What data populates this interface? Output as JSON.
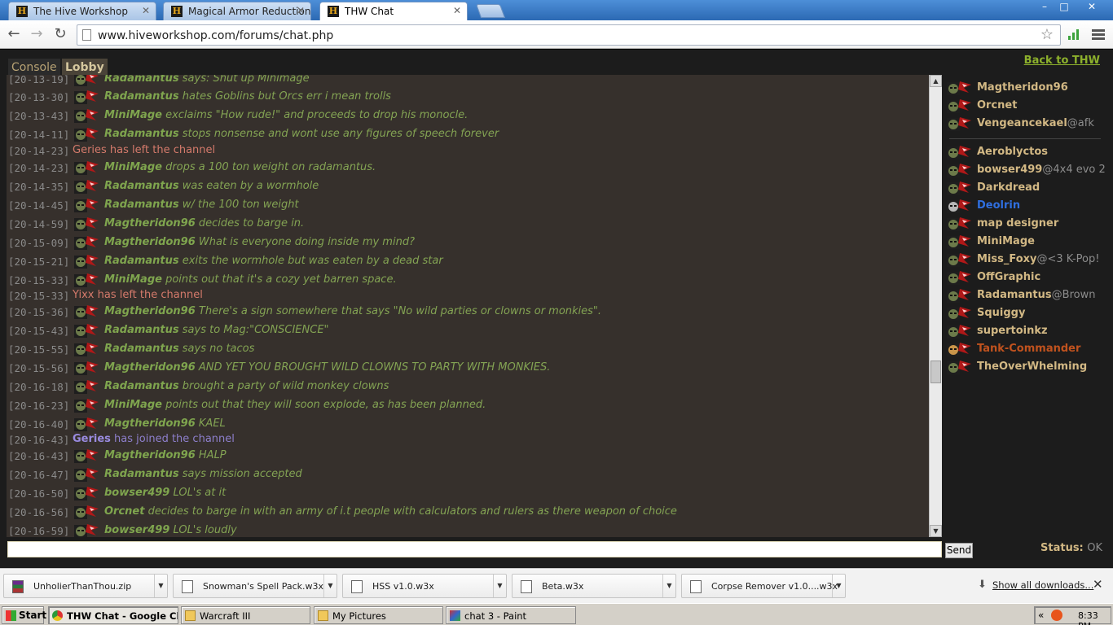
{
  "browser": {
    "tabs": [
      {
        "title": "The Hive Workshop",
        "favicon": "H"
      },
      {
        "title": "Magical Armor Reduction - Th",
        "favicon": "H"
      },
      {
        "title": "THW Chat",
        "favicon": "H"
      }
    ],
    "url": "www.hiveworkshop.com/forums/chat.php",
    "window_controls": [
      "–",
      "□",
      "✕"
    ]
  },
  "chat": {
    "channel_tabs": [
      "Console",
      "Lobby"
    ],
    "back_link": "Back to THW",
    "log": [
      {
        "ts": "[20-13-19]",
        "kind": "partial",
        "user": "Radamantus",
        "text": "says: Shut up Minimage"
      },
      {
        "ts": "[20-13-30]",
        "kind": "msg",
        "user": "Radamantus",
        "text": "hates Goblins but Orcs err i mean trolls"
      },
      {
        "ts": "[20-13-43]",
        "kind": "msg",
        "user": "MiniMage",
        "text": "exclaims \"How rude!\" and proceeds to drop his monocle."
      },
      {
        "ts": "[20-14-11]",
        "kind": "msg",
        "user": "Radamantus",
        "text": "stops nonsense and wont use any figures of speech forever"
      },
      {
        "ts": "[20-14-23]",
        "kind": "leave",
        "text": "Geries has left the channel"
      },
      {
        "ts": "[20-14-23]",
        "kind": "msg",
        "user": "MiniMage",
        "text": "drops a 100 ton weight on radamantus."
      },
      {
        "ts": "[20-14-35]",
        "kind": "msg",
        "user": "Radamantus",
        "text": "was eaten by a wormhole"
      },
      {
        "ts": "[20-14-45]",
        "kind": "msg",
        "user": "Radamantus",
        "text": "w/ the 100 ton weight"
      },
      {
        "ts": "[20-14-59]",
        "kind": "msg",
        "user": "Magtheridon96",
        "text": "decides to barge in."
      },
      {
        "ts": "[20-15-09]",
        "kind": "msg",
        "user": "Magtheridon96",
        "text": "What is everyone doing inside my mind?"
      },
      {
        "ts": "[20-15-21]",
        "kind": "msg",
        "user": "Radamantus",
        "text": "exits the wormhole but was eaten by a dead star"
      },
      {
        "ts": "[20-15-33]",
        "kind": "msg",
        "user": "MiniMage",
        "text": "points out that it's a cozy yet barren space."
      },
      {
        "ts": "[20-15-33]",
        "kind": "leave",
        "text": "Yixx has left the channel"
      },
      {
        "ts": "[20-15-36]",
        "kind": "msg",
        "user": "Magtheridon96",
        "text": "There's a sign somewhere that says \"No wild parties or clowns or monkies\"."
      },
      {
        "ts": "[20-15-43]",
        "kind": "msg",
        "user": "Radamantus",
        "text": "says to Mag:\"CONSCIENCE\""
      },
      {
        "ts": "[20-15-55]",
        "kind": "msg",
        "user": "Radamantus",
        "text": "says no tacos"
      },
      {
        "ts": "[20-15-56]",
        "kind": "msg",
        "user": "Magtheridon96",
        "text": "AND YET YOU BROUGHT WILD CLOWNS TO PARTY WITH MONKIES."
      },
      {
        "ts": "[20-16-18]",
        "kind": "msg",
        "user": "Radamantus",
        "text": "brought a party of wild monkey clowns"
      },
      {
        "ts": "[20-16-23]",
        "kind": "msg",
        "user": "MiniMage",
        "text": "points out that they will soon explode, as has been planned."
      },
      {
        "ts": "[20-16-40]",
        "kind": "msg",
        "user": "Magtheridon96",
        "text": "KAEL"
      },
      {
        "ts": "[20-16-43]",
        "kind": "join",
        "user": "Geries",
        "text": "has joined the channel"
      },
      {
        "ts": "[20-16-43]",
        "kind": "msg",
        "user": "Magtheridon96",
        "text": "HALP"
      },
      {
        "ts": "[20-16-47]",
        "kind": "msg",
        "user": "Radamantus",
        "text": "says mission accepted"
      },
      {
        "ts": "[20-16-50]",
        "kind": "msg",
        "user": "bowser499",
        "text": "LOL's at it"
      },
      {
        "ts": "[20-16-56]",
        "kind": "msg",
        "user": "Orcnet",
        "text": "decides to barge in with an army of i.t people with calculators and rulers as there weapon of choice"
      },
      {
        "ts": "[20-16-59]",
        "kind": "msg",
        "user": "bowser499",
        "text": "LOL's loudly"
      }
    ],
    "users_top": [
      {
        "name": "Magtheridon96",
        "status": "",
        "color": "#d2b884"
      },
      {
        "name": "Orcnet",
        "status": "",
        "color": "#d2b884"
      },
      {
        "name": "Vengeancekael",
        "status": "@afk",
        "color": "#d2b884"
      }
    ],
    "users": [
      {
        "name": "Aeroblyctos",
        "status": "",
        "color": "#d2b884"
      },
      {
        "name": "bowser499",
        "status": "@4x4 evo 2",
        "color": "#d2b884"
      },
      {
        "name": "Darkdread",
        "status": "",
        "color": "#d2b884"
      },
      {
        "name": "Deolrin",
        "status": "",
        "color": "#2f6fe0"
      },
      {
        "name": "map designer",
        "status": "",
        "color": "#d2b884"
      },
      {
        "name": "MiniMage",
        "status": "",
        "color": "#d2b884"
      },
      {
        "name": "Miss_Foxy",
        "status": "@<3 K-Pop!",
        "color": "#d2b884"
      },
      {
        "name": "OffGraphic",
        "status": "",
        "color": "#d2b884"
      },
      {
        "name": "Radamantus",
        "status": "@Brown",
        "color": "#d2b884"
      },
      {
        "name": "Squiggy",
        "status": "",
        "color": "#d2b884"
      },
      {
        "name": "supertoinkz",
        "status": "",
        "color": "#d2b884"
      },
      {
        "name": "Tank-Commander",
        "status": "",
        "color": "#c0521e"
      },
      {
        "name": "TheOverWhelming",
        "status": "",
        "color": "#d2b884"
      }
    ],
    "send_label": "Send",
    "status_label": "Status:",
    "status_value": "OK"
  },
  "downloads": {
    "items": [
      {
        "name": "UnholierThanThou.zip",
        "icon": "zip-icon"
      },
      {
        "name": "Snowman's Spell Pack.w3x",
        "icon": "map-file-icon"
      },
      {
        "name": "HSS v1.0.w3x",
        "icon": "map-file-icon"
      },
      {
        "name": "Beta.w3x",
        "icon": "map-file-icon"
      },
      {
        "name": "Corpse Remover v1.0....w3x",
        "icon": "map-file-icon"
      }
    ],
    "show_all": "Show all downloads..."
  },
  "taskbar": {
    "start": "Start",
    "tasks": [
      {
        "label": "THW Chat - Google Ch...",
        "icon": "chrome-icon",
        "active": true
      },
      {
        "label": "Warcraft III",
        "icon": "folder-icon",
        "active": false
      },
      {
        "label": "My Pictures",
        "icon": "folder-icon",
        "active": false
      },
      {
        "label": "chat 3 - Paint",
        "icon": "paint-icon",
        "active": false
      }
    ],
    "clock": "8:33 PM"
  }
}
